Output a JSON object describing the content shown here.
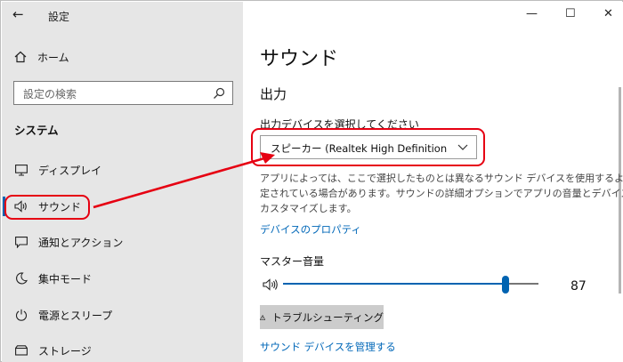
{
  "window": {
    "title": "設定",
    "back_glyph": "←",
    "minimize_glyph": "—",
    "maximize_glyph": "☐",
    "close_glyph": "✕"
  },
  "sidebar": {
    "home_label": "ホーム",
    "search_placeholder": "設定の検索",
    "section": "システム",
    "items": [
      {
        "label": "ディスプレイ",
        "icon": "monitor-icon"
      },
      {
        "label": "サウンド",
        "icon": "speaker-icon",
        "selected": true
      },
      {
        "label": "通知とアクション",
        "icon": "notification-icon"
      },
      {
        "label": "集中モード",
        "icon": "moon-icon"
      },
      {
        "label": "電源とスリープ",
        "icon": "power-icon"
      },
      {
        "label": "ストレージ",
        "icon": "storage-icon"
      }
    ]
  },
  "main": {
    "title": "サウンド",
    "output_heading": "出力",
    "device_label": "出力デバイスを選択してください",
    "device_value": "スピーカー (Realtek High Definition Au...",
    "description": [
      "アプリによっては、ここで選択したものとは異なるサウンド デバイスを使用するように設",
      "定されている場合があります。サウンドの詳細オプションでアプリの音量とデバイスを",
      "カスタマイズします。"
    ],
    "device_properties_link": "デバイスのプロパティ",
    "master_volume_label": "マスター音量",
    "master_volume_value": "87",
    "master_volume_level": 87,
    "troubleshoot_label": "トラブルシューティング",
    "manage_devices_link": "サウンド デバイスを管理する"
  },
  "colors": {
    "accent": "#0063b1",
    "link": "#0067b8",
    "annotation": "#e60012",
    "sidebar_bg": "#e6e6e6"
  }
}
